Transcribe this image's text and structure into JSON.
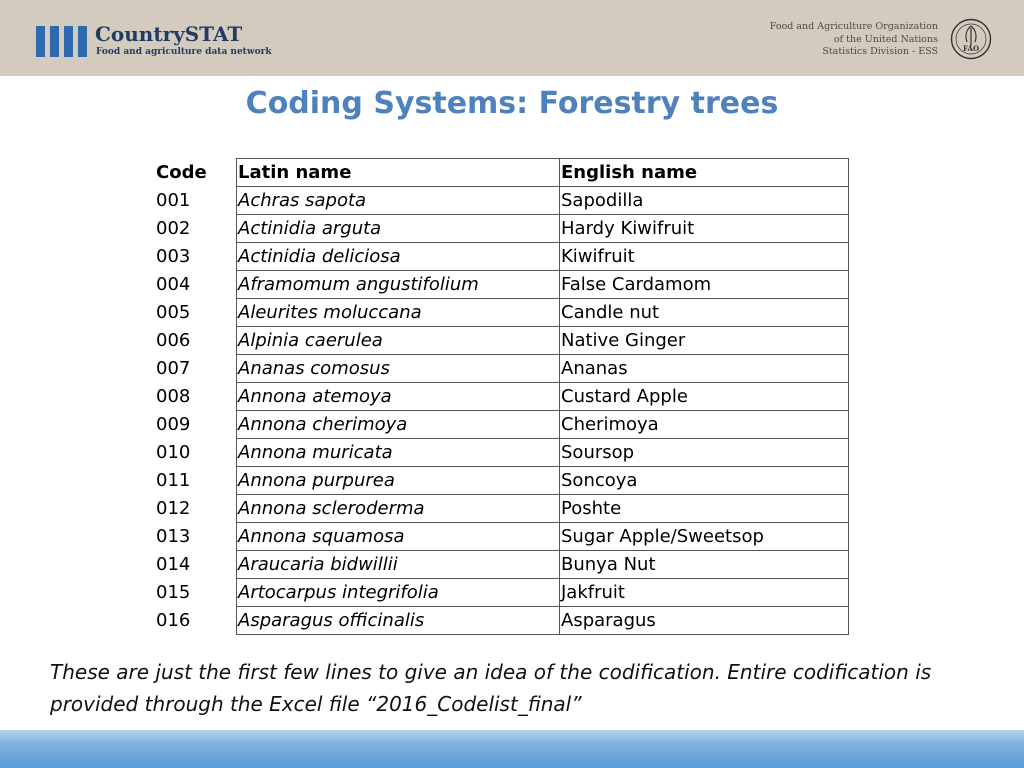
{
  "header": {
    "brand_name": "CountrySTAT",
    "brand_tagline": "Food and agriculture data network",
    "org_lines": [
      "Food and Agriculture Organization",
      "of the United Nations",
      "Statistics Division - ESS"
    ],
    "fao_logo_text": "FAO",
    "brand_color": "#2f6ab1"
  },
  "title": "Coding Systems: Forestry trees",
  "table": {
    "headers": {
      "code": "Code",
      "latin": "Latin name",
      "english": "English name"
    },
    "rows": [
      {
        "code": "001",
        "latin": "Achras sapota",
        "english": "Sapodilla"
      },
      {
        "code": "002",
        "latin": "Actinidia arguta",
        "english": "Hardy Kiwifruit"
      },
      {
        "code": "003",
        "latin": "Actinidia deliciosa",
        "english": "Kiwifruit"
      },
      {
        "code": "004",
        "latin": "Aframomum angustifolium",
        "english": "False Cardamom"
      },
      {
        "code": "005",
        "latin": "Aleurites moluccana",
        "english": "Candle nut"
      },
      {
        "code": "006",
        "latin": "Alpinia caerulea",
        "english": "Native Ginger"
      },
      {
        "code": "007",
        "latin": "Ananas comosus",
        "english": "Ananas"
      },
      {
        "code": "008",
        "latin": "Annona atemoya",
        "english": "Custard Apple"
      },
      {
        "code": "009",
        "latin": "Annona cherimoya",
        "english": "Cherimoya"
      },
      {
        "code": "010",
        "latin": "Annona muricata",
        "english": "Soursop"
      },
      {
        "code": "011",
        "latin": "Annona purpurea",
        "english": "Soncoya"
      },
      {
        "code": "012",
        "latin": "Annona scleroderma",
        "english": "Poshte"
      },
      {
        "code": "013",
        "latin": "Annona squamosa",
        "english": "Sugar Apple/Sweetsop"
      },
      {
        "code": "014",
        "latin": "Araucaria bidwillii",
        "english": "Bunya Nut"
      },
      {
        "code": "015",
        "latin": "Artocarpus integrifolia",
        "english": "Jakfruit"
      },
      {
        "code": "016",
        "latin": "Asparagus officinalis",
        "english": "Asparagus"
      }
    ]
  },
  "note": "These are just the first few lines to give an idea of the codification. Entire codification is provided through the Excel file “2016_Codelist_final”"
}
